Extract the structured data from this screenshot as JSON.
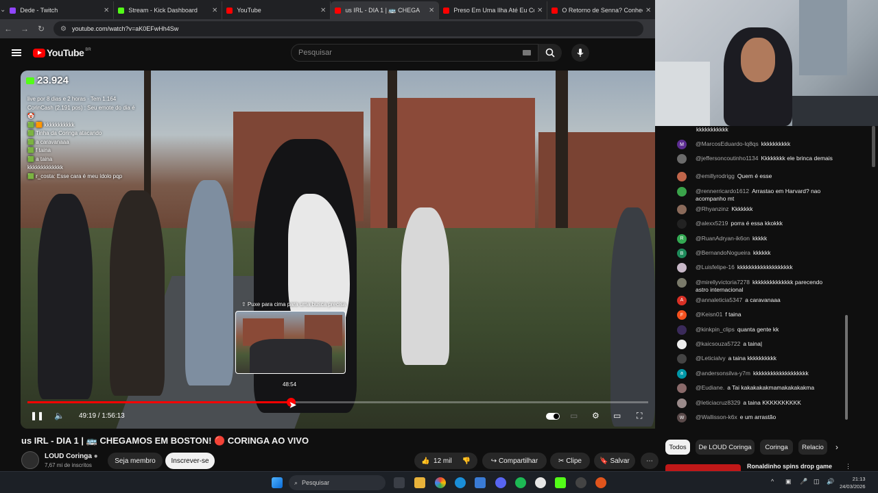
{
  "browser": {
    "tabs": [
      {
        "title": "Dede - Twitch",
        "color": "#9146ff"
      },
      {
        "title": "Stream - Kick Dashboard",
        "color": "#53fc18"
      },
      {
        "title": "YouTube",
        "color": "#ff0000"
      },
      {
        "title": "us IRL - DIA 1 | 🚌 CHEGA",
        "color": "#ff0000"
      },
      {
        "title": "Preso Em Uma Ilha Até Eu Con",
        "color": "#ff0000"
      },
      {
        "title": "O Retorno de Senna? Conheça",
        "color": "#ff0000"
      }
    ],
    "active_tab": 3,
    "url": "youtube.com/watch?v=aK0EFwHh4Sw"
  },
  "youtube": {
    "logo_text": "YouTube",
    "country": "BR",
    "search_placeholder": "Pesquisar"
  },
  "player": {
    "viewers": "23.924",
    "overlay_chat": [
      "live por 8 dias e 2 horas · Tem 1.164",
      "CorinCash (2.191 pos) : Seu emote do dia é 🤡",
      "🟩 🟧 kkkkkkkkkkk",
      "🟩 Tinha da Coringa atacando",
      "🟩 a caravanaaa",
      "🟩 f taina",
      "🟩 a taina",
      "kkkkkkkkkkkkk",
      "🟩 r_costa: Esse cara é meu ídolo pqp"
    ],
    "preview_label": "⇧ Puxe para cima para uma busca precisa",
    "preview_time": "48:54",
    "current_time": "49:19",
    "duration": "1:56:13",
    "time_display": "49:19 / 1:56:13",
    "progress_fraction": 0.4243,
    "buffer_fraction": 0.44
  },
  "video": {
    "title": "us IRL - DIA 1 | 🚌 CHEGAMOS EM BOSTON! 🔴 CORINGA AO VIVO",
    "channel": "LOUD Coringa",
    "subscribers": "7,67 mi de inscritos",
    "join_label": "Seja membro",
    "subscribe_label": "Inscrever-se",
    "likes": "12 mil",
    "share_label": "Compartilhar",
    "clip_label": "Clipe",
    "save_label": "Salvar"
  },
  "chat": {
    "truncated_top": "kkkkkkkkkkk",
    "messages": [
      {
        "user": "@MarcosEduardo-lq8qs",
        "text": "kkkkkkkkkk",
        "initial": "M",
        "color": "#5c2d91"
      },
      {
        "user": "@jeffersoncoutinho1134",
        "text": "Kkkkkkkk ele brinca demais",
        "initial": "",
        "color": "#6b6b6b"
      },
      {
        "user": "@emillyrodrigg",
        "text": "Quem é esse",
        "initial": "",
        "color": "#c0654a"
      },
      {
        "user": "@rennerricardo1612",
        "text": "Arrastao em Harvard? nao acompanho mt",
        "initial": "",
        "color": "#3aa34a"
      },
      {
        "user": "@Rhyanzinz",
        "text": "Kkkkkkk",
        "initial": "",
        "color": "#8a6a5a"
      },
      {
        "user": "@alexx5219",
        "text": "porra é essa kkokkk",
        "initial": "",
        "color": "#222222"
      },
      {
        "user": "@RuanAdryan-ik6on",
        "text": "kkkkk",
        "initial": "R",
        "color": "#33a852"
      },
      {
        "user": "@BernandoNogueira",
        "text": "kkkkkk",
        "initial": "B",
        "color": "#1e8a5a"
      },
      {
        "user": "@Luisfelipe-16",
        "text": "kkkkkkkkkkkkkkkkkkk",
        "initial": "",
        "color": "#c8b8c8"
      },
      {
        "user": "@mirellyvictoria7278",
        "text": "kkkkkkkkkkkkkk parecendo astro internacional",
        "initial": "",
        "color": "#7a7a6a"
      },
      {
        "user": "@annaleticia5347",
        "text": "a caravanaaa",
        "initial": "A",
        "color": "#d93025"
      },
      {
        "user": "@Keisn01",
        "text": "f taina",
        "initial": "F",
        "color": "#f4511e"
      },
      {
        "user": "@kinkpin_clips",
        "text": "quanta gente kk",
        "initial": "",
        "color": "#3a2a5a"
      },
      {
        "user": "@kaicsouza5722",
        "text": "a taina|",
        "initial": "",
        "color": "#eeeeee"
      },
      {
        "user": "@Leticialvy",
        "text": "a taina kkkkkkkkkk",
        "initial": "",
        "color": "#444444"
      },
      {
        "user": "@andersonsilva-y7m",
        "text": "kkkkkkkkkkkkkkkkkkk",
        "initial": "a",
        "color": "#0097a7"
      },
      {
        "user": "@Eudiane.",
        "text": "a Tai kakakakakmamakakakakma",
        "initial": "",
        "color": "#8a6a6a"
      },
      {
        "user": "@leticiacruz8329",
        "text": "a taina KKKKKKKKKK",
        "initial": "",
        "color": "#9a8a8a"
      },
      {
        "user": "@Wallisson-k6x",
        "text": "e um arrastão",
        "initial": "W",
        "color": "#5a4a4a"
      }
    ]
  },
  "chips": [
    "Todos",
    "De LOUD Coringa",
    "Coringa",
    "Relacio"
  ],
  "recommendation": {
    "title": "Ronaldinho spins drop game"
  },
  "taskbar": {
    "search_placeholder": "Pesquisar",
    "time": "21:13",
    "date": "24/03/2026"
  }
}
